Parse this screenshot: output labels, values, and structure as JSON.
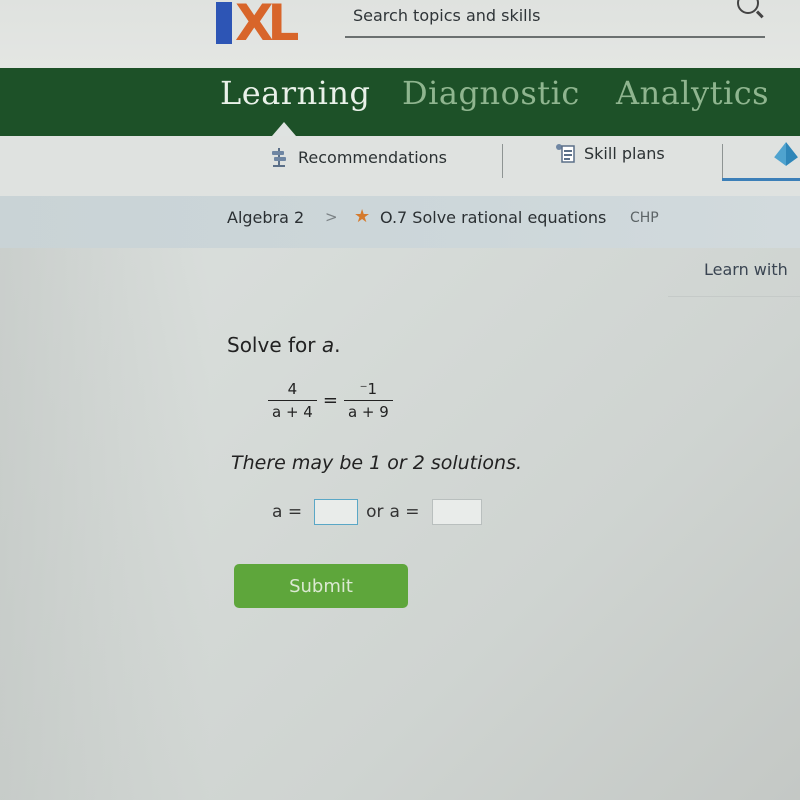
{
  "header": {
    "logo_text_i": "I",
    "logo_text_xl": "XL",
    "search_placeholder": "Search topics and skills"
  },
  "nav": {
    "tabs": [
      {
        "label": "Learning",
        "active": true
      },
      {
        "label": "Diagnostic",
        "active": false
      },
      {
        "label": "Analytics",
        "active": false
      }
    ]
  },
  "subnav": {
    "items": [
      {
        "label": "Recommendations",
        "icon": "signpost-icon"
      },
      {
        "label": "Skill plans",
        "icon": "skill-plan-icon"
      },
      {
        "label": "",
        "icon": "pyramid-icon"
      }
    ]
  },
  "breadcrumb": {
    "course": "Algebra 2",
    "separator": ">",
    "skill": "O.7 Solve rational equations",
    "skill_code": "CHP"
  },
  "learn_with": "Learn with",
  "question": {
    "prompt": "Solve for",
    "variable": "a",
    "prompt_end": ".",
    "equation": {
      "left_num": "4",
      "left_den": "a + 4",
      "equals": "=",
      "right_num": "⁻1",
      "right_den": "a + 9"
    },
    "note": "There may be 1 or 2 solutions.",
    "answer_label_1": "a =",
    "answer_value_1": "",
    "or_label": "or",
    "answer_label_2": "a =",
    "answer_value_2": ""
  },
  "submit_label": "Submit",
  "colors": {
    "nav_green": "#1d5128",
    "submit_green": "#5ea63b",
    "logo_blue": "#2d55b5",
    "logo_orange": "#d8652a",
    "star_orange": "#d57a2c"
  }
}
